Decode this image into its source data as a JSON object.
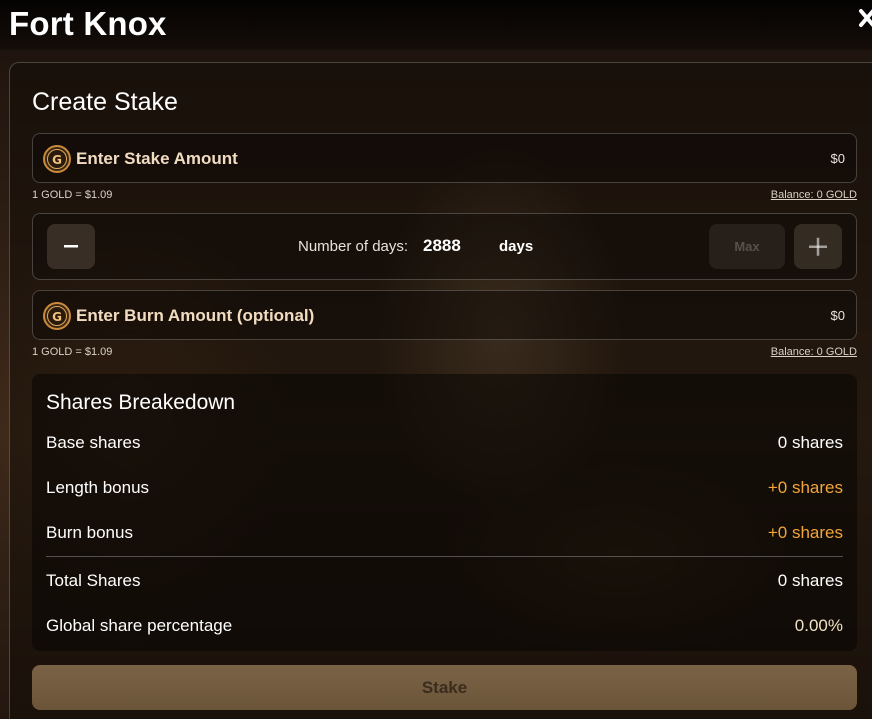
{
  "app": {
    "title": "Fort Knox"
  },
  "create": {
    "title": "Create Stake"
  },
  "stake_field": {
    "placeholder": "Enter Stake Amount",
    "usd_value": "$0",
    "rate": "1 GOLD = $1.09",
    "balance": "Balance: 0 GOLD"
  },
  "days": {
    "label": "Number of days:",
    "value": "2888",
    "unit": "days",
    "max_label": "Max"
  },
  "burn_field": {
    "placeholder": "Enter Burn Amount (optional)",
    "usd_value": "$0",
    "rate": "1 GOLD = $1.09",
    "balance": "Balance: 0 GOLD"
  },
  "breakdown": {
    "title": "Shares Breakedown",
    "rows": [
      {
        "label": "Base shares",
        "value": "0 shares"
      },
      {
        "label": "Length bonus",
        "value": "+0 shares"
      },
      {
        "label": "Burn bonus",
        "value": "+0 shares"
      },
      {
        "label": "Total Shares",
        "value": "0 shares"
      },
      {
        "label": "Global share percentage",
        "value": "0.00%"
      }
    ]
  },
  "actions": {
    "stake_label": "Stake"
  },
  "colors": {
    "accent": "#f2a53a",
    "coin_gold": "#c98a3c",
    "button_disabled": "#6b5539"
  }
}
